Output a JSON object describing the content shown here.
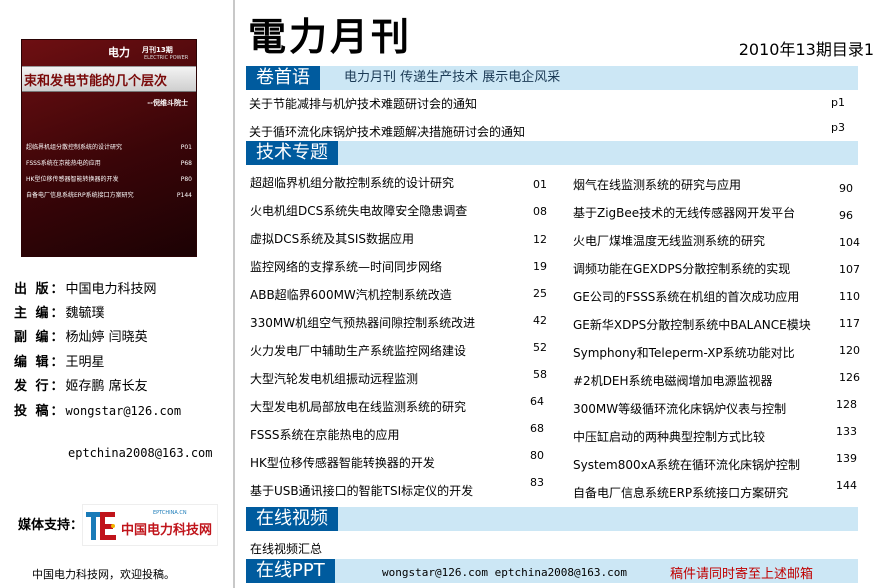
{
  "cover": {
    "brand": "电力",
    "issue": "月刊13期",
    "en": "ELECTRIC POWER",
    "headline": "束和发电节能的几个层次",
    "author": "--倪维斗院士",
    "toc": [
      {
        "title": "超临界机组分散控制系统的设计研究",
        "page": "P01"
      },
      {
        "title": "FSSS系统在京能热电的应用",
        "page": "P68"
      },
      {
        "title": "HK型位移传感器智能转换器的开发",
        "page": "P80"
      },
      {
        "title": "自备电厂信息系统ERP系统接口方案研究",
        "page": "P144"
      }
    ]
  },
  "info": [
    {
      "label": "出  版：",
      "value": "中国电力科技网"
    },
    {
      "label": "主  编：",
      "value": "魏毓璞"
    },
    {
      "label": "副  编：",
      "value": "杨灿婷  闫晓英"
    },
    {
      "label": "编  辑：",
      "value": "王明星"
    },
    {
      "label": "发  行：",
      "value": "姬存鹏  席长友"
    },
    {
      "label": "投  稿：",
      "value": "wongstar@126.com"
    }
  ],
  "info_extra_email": "eptchina2008@163.com",
  "sponsor": {
    "label": "媒体支持：",
    "logo_text": "中国电力科技网",
    "logo_small": "EPTCHINA.CN"
  },
  "footer_left": "中国电力科技网，欢迎投稿。",
  "masthead": "電力月刊",
  "issue_title": "2010年13期目录1",
  "sections": {
    "lead": {
      "title": "卷首语",
      "slogan": "电力月刊  传递生产技术   展示电企风采"
    },
    "tech": {
      "title": "技术专题"
    },
    "video": {
      "title": "在线视频"
    },
    "ppt": {
      "title": "在线PPT"
    }
  },
  "lead_items": [
    {
      "title": "关于节能减排与机炉技术难题研讨会的通知",
      "page": "p1"
    },
    {
      "title": "关于循环流化床锅炉技术难题解决措施研讨会的通知",
      "page": "p3"
    }
  ],
  "tech_left": [
    {
      "title": "超超临界机组分散控制系统的设计研究",
      "page": "01"
    },
    {
      "title": "火电机组DCS系统失电故障安全隐患调查",
      "page": "08"
    },
    {
      "title": "虚拟DCS系统及其SIS数据应用",
      "page": "12"
    },
    {
      "title": "监控网络的支撑系统—时间同步网络",
      "page": "19"
    },
    {
      "title": "ABB超临界600MW汽机控制系统改造",
      "page": "25"
    },
    {
      "title": "330MW机组空气预热器间隙控制系统改进",
      "page": "42"
    },
    {
      "title": "火力发电厂中辅助生产系统监控网络建设",
      "page": "52"
    },
    {
      "title": "大型汽轮发电机组振动远程监测",
      "page": "58"
    },
    {
      "title": "大型发电机局部放电在线监测系统的研究",
      "page": "64"
    },
    {
      "title": "FSSS系统在京能热电的应用",
      "page": "68"
    },
    {
      "title": "HK型位移传感器智能转换器的开发",
      "page": "80"
    },
    {
      "title": "基于USB通讯接口的智能TSI标定仪的开发",
      "page": "83"
    }
  ],
  "tech_right": [
    {
      "title": "烟气在线监测系统的研究与应用",
      "page": "90"
    },
    {
      "title": "基于ZigBee技术的无线传感器网开发平台",
      "page": "96"
    },
    {
      "title": "火电厂煤堆温度无线监测系统的研究",
      "page": "104"
    },
    {
      "title": "调频功能在GEXDPS分散控制系统的实现",
      "page": "107"
    },
    {
      "title": "GE公司的FSSS系统在机组的首次成功应用",
      "page": "110"
    },
    {
      "title": "GE新华XDPS分散控制系统中BALANCE模块",
      "page": "117"
    },
    {
      "title": "Symphony和Teleperm-XP系统功能对比",
      "page": "120"
    },
    {
      "title": "#2机DEH系统电磁阀增加电源监视器",
      "page": "126"
    },
    {
      "title": "300MW等级循环流化床锅炉仪表与控制",
      "page": "128"
    },
    {
      "title": "中压缸启动的两种典型控制方式比较",
      "page": "133"
    },
    {
      "title": "System800xA系统在循环流化床锅炉控制",
      "page": "139"
    },
    {
      "title": "自备电厂信息系统ERP系统接口方案研究",
      "page": "144"
    }
  ],
  "video_item": "在线视频汇总",
  "ppt": {
    "emails": "wongstar@126.com   eptchina2008@163.com",
    "note": "稿件请同时寄至上述邮箱"
  }
}
